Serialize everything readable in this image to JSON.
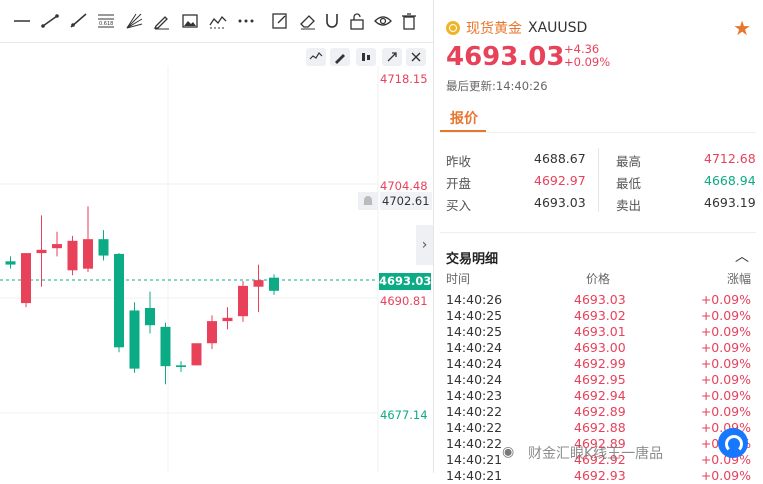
{
  "chart": {
    "price_labels": {
      "top": "4718.15",
      "upper": "4704.48",
      "hover": "4702.61",
      "current": "4693.03",
      "lower": "4690.81",
      "bottom": "4677.14"
    },
    "tools": [
      "horizontal-line-icon",
      "trend-line-icon",
      "ray-icon",
      "fib-icon",
      "fan-icon",
      "pencil-icon",
      "image-icon",
      "chart-line-icon",
      "more-icon",
      "note-icon",
      "eraser-icon",
      "magnet-icon",
      "unlock-icon",
      "eye-icon",
      "trash-icon"
    ],
    "colors": {
      "up": "#e8415a",
      "down": "#0bab85"
    }
  },
  "chart_data": {
    "type": "candlestick",
    "ylim": [
      4677.14,
      4718.15
    ],
    "candles": [
      {
        "o": 4696.8,
        "h": 4697.5,
        "c": 4696.6,
        "l": 4696.0
      },
      {
        "o": 4695.9,
        "h": 4696.5,
        "c": 4695.5,
        "l": 4695.0
      },
      {
        "o": 4690.8,
        "h": 4694.0,
        "c": 4696.9,
        "l": 4690.3
      },
      {
        "o": 4696.9,
        "h": 4701.5,
        "c": 4697.3,
        "l": 4692.8
      },
      {
        "o": 4697.5,
        "h": 4699.5,
        "c": 4698.0,
        "l": 4696.5
      },
      {
        "o": 4694.8,
        "h": 4699.0,
        "c": 4698.4,
        "l": 4694.2
      },
      {
        "o": 4695.0,
        "h": 4702.6,
        "c": 4698.6,
        "l": 4694.6
      },
      {
        "o": 4698.6,
        "h": 4699.7,
        "c": 4696.6,
        "l": 4696.0
      },
      {
        "o": 4696.8,
        "h": 4696.9,
        "c": 4685.4,
        "l": 4684.8
      },
      {
        "o": 4689.9,
        "h": 4690.9,
        "c": 4682.8,
        "l": 4682.3
      },
      {
        "o": 4690.2,
        "h": 4692.2,
        "c": 4688.1,
        "l": 4687.1
      },
      {
        "o": 4687.9,
        "h": 4688.4,
        "c": 4683.1,
        "l": 4680.9
      },
      {
        "o": 4683.2,
        "h": 4683.7,
        "c": 4683.0,
        "l": 4682.4
      },
      {
        "o": 4683.2,
        "h": 4685.5,
        "c": 4685.9,
        "l": 4683.2
      },
      {
        "o": 4685.9,
        "h": 4689.3,
        "c": 4688.6,
        "l": 4685.2
      },
      {
        "o": 4688.6,
        "h": 4690.3,
        "c": 4689.0,
        "l": 4687.6
      },
      {
        "o": 4689.2,
        "h": 4693.5,
        "c": 4692.9,
        "l": 4688.5
      },
      {
        "o": 4692.8,
        "h": 4695.5,
        "c": 4693.6,
        "l": 4689.7
      },
      {
        "o": 4693.9,
        "h": 4694.3,
        "c": 4692.3,
        "l": 4691.8
      }
    ]
  },
  "quote": {
    "name_cn": "现货黄金",
    "name_en": "XAUUSD",
    "price": "4693.03",
    "change": "+4.36",
    "change_pct": "+0.09%",
    "updated_label": "最后更新:",
    "updated_time": "14:40:26"
  },
  "tab": "报价",
  "stats": {
    "prev_close": {
      "label": "昨收",
      "value": "4688.67"
    },
    "open": {
      "label": "开盘",
      "value": "4692.97"
    },
    "bid": {
      "label": "买入",
      "value": "4693.03"
    },
    "high": {
      "label": "最高",
      "value": "4712.68"
    },
    "low": {
      "label": "最低",
      "value": "4668.94"
    },
    "ask": {
      "label": "卖出",
      "value": "4693.19"
    }
  },
  "trades": {
    "title": "交易明细",
    "headers": {
      "time": "时间",
      "price": "价格",
      "change": "涨幅"
    },
    "rows": [
      {
        "time": "14:40:26",
        "price": "4693.03",
        "change": "+0.09%"
      },
      {
        "time": "14:40:25",
        "price": "4693.02",
        "change": "+0.09%"
      },
      {
        "time": "14:40:25",
        "price": "4693.01",
        "change": "+0.09%"
      },
      {
        "time": "14:40:24",
        "price": "4693.00",
        "change": "+0.09%"
      },
      {
        "time": "14:40:24",
        "price": "4692.99",
        "change": "+0.09%"
      },
      {
        "time": "14:40:24",
        "price": "4692.95",
        "change": "+0.09%"
      },
      {
        "time": "14:40:23",
        "price": "4692.94",
        "change": "+0.09%"
      },
      {
        "time": "14:40:22",
        "price": "4692.89",
        "change": "+0.09%"
      },
      {
        "time": "14:40:22",
        "price": "4692.88",
        "change": "+0.09%"
      },
      {
        "time": "14:40:22",
        "price": "4692.89",
        "change": "+0.09%"
      },
      {
        "time": "14:40:21",
        "price": "4692.92",
        "change": "+0.09%"
      },
      {
        "time": "14:40:21",
        "price": "4692.93",
        "change": "+0.09%"
      }
    ]
  },
  "watermark": "财金汇眼K线王一唐品"
}
